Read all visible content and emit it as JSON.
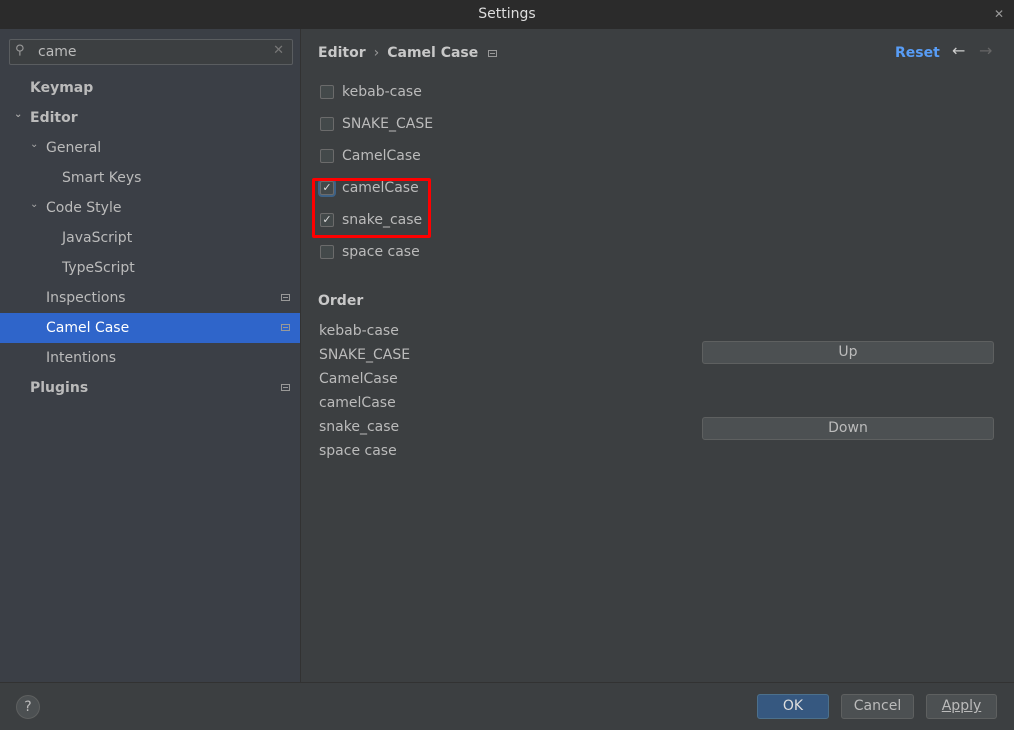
{
  "window": {
    "title": "Settings"
  },
  "search": {
    "value": "came"
  },
  "tree": [
    {
      "label": "Keymap",
      "level": 0,
      "bold": true
    },
    {
      "label": "Editor",
      "level": 0,
      "bold": true,
      "expanded": true
    },
    {
      "label": "General",
      "level": 1,
      "expanded": true
    },
    {
      "label": "Smart Keys",
      "level": 2
    },
    {
      "label": "Code Style",
      "level": 1,
      "expanded": true
    },
    {
      "label": "JavaScript",
      "level": 2
    },
    {
      "label": "TypeScript",
      "level": 2
    },
    {
      "label": "Inspections",
      "level": 1,
      "page_icon": true
    },
    {
      "label": "Camel Case",
      "level": 1,
      "page_icon": true,
      "selected": true
    },
    {
      "label": "Intentions",
      "level": 1
    },
    {
      "label": "Plugins",
      "level": 0,
      "bold": true,
      "page_icon": true
    }
  ],
  "breadcrumb": {
    "parent": "Editor",
    "sep": "›",
    "current": "Camel Case"
  },
  "header": {
    "reset": "Reset",
    "back": "←",
    "forward": "→"
  },
  "options": [
    {
      "label": "kebab-case",
      "checked": false
    },
    {
      "label": "SNAKE_CASE",
      "checked": false
    },
    {
      "label": "CamelCase",
      "checked": false
    },
    {
      "label": "camelCase",
      "checked": true,
      "focused": true
    },
    {
      "label": "snake_case",
      "checked": true
    },
    {
      "label": "space case",
      "checked": false
    }
  ],
  "order": {
    "title": "Order",
    "items": [
      "kebab-case",
      "SNAKE_CASE",
      "CamelCase",
      "camelCase",
      "snake_case",
      "space case"
    ],
    "up": "Up",
    "down": "Down"
  },
  "footer": {
    "help": "?",
    "ok": "OK",
    "cancel": "Cancel",
    "apply": "Apply"
  },
  "colors": {
    "accent": "#2f65ca",
    "link": "#589df6",
    "highlight": "#ff0000",
    "ok": "#365880"
  }
}
